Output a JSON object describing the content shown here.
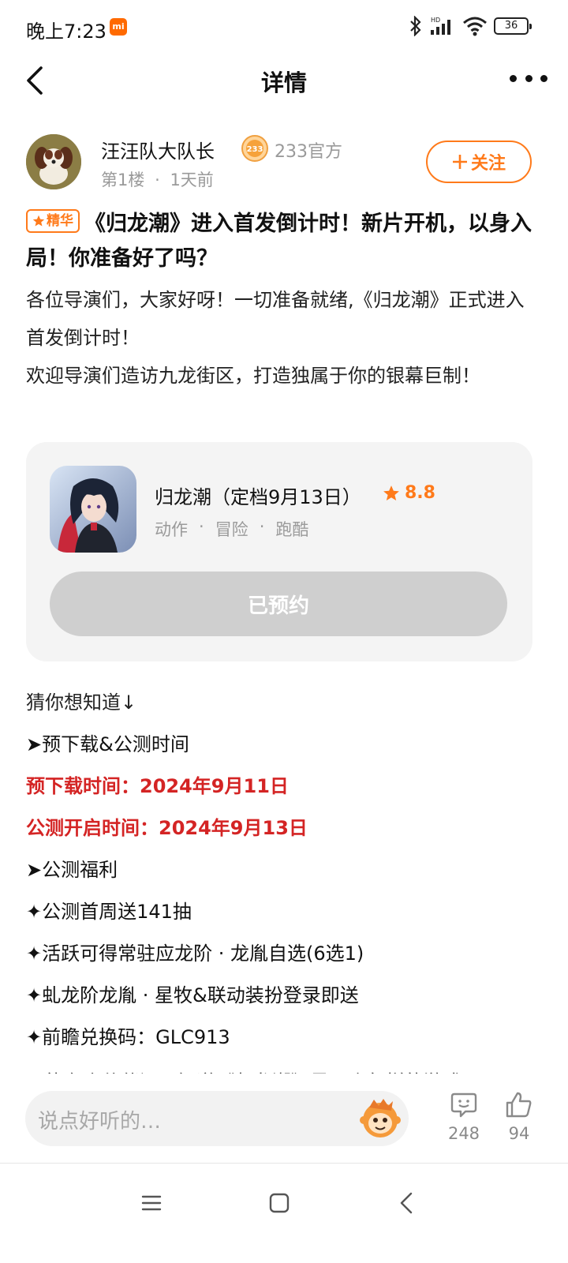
{
  "status_bar": {
    "time": "晚上7:23",
    "mi_badge": "mi",
    "battery": "36"
  },
  "nav": {
    "title": "详情"
  },
  "author": {
    "name": "汪汪队大队长",
    "badge_text": "233",
    "official_label": "233官方",
    "floor": "第1楼",
    "separator": "·",
    "time_ago": "1天前",
    "follow_label": "关注"
  },
  "post": {
    "tag": "精华",
    "title": "《归龙潮》进入首发倒计时！新片开机，以身入局！你准备好了吗？",
    "paragraphs": [
      "各位导演们，大家好呀！一切准备就绪,《归龙潮》正式进入首发倒计时！",
      "欢迎导演们造访九龙街区，打造独属于你的银幕巨制！"
    ]
  },
  "game_card": {
    "name": "归龙潮（定档9月13日）",
    "rating": "8.8",
    "tags": [
      "动作",
      "·",
      "冒险",
      "·",
      "跑酷"
    ],
    "reserve_label": "已预约",
    "reserved": true
  },
  "content": {
    "lines": [
      "猜你想知道↓",
      "➤预下载&公测时间",
      "预下载时间：2024年9月11日",
      "公测开启时间：2024年9月13日",
      "➤公测福利",
      "✦公测首周送141抽",
      "✦活跃可得常驻应龙阶 · 龙胤自选(6选1)",
      "✦虬龙阶龙胤 · 星牧&联动装扮登录即送",
      "✦前瞻兑换码：GLC913",
      "可能有小伙伴还不知道《归龙潮》是一个怎样的游戏"
    ]
  },
  "comment_bar": {
    "placeholder": "说点好听的…",
    "comment_count": "248",
    "like_count": "94"
  },
  "colors": {
    "accent": "#ff7a1a",
    "highlight_red": "#d42424",
    "muted": "#9a9a9a"
  }
}
